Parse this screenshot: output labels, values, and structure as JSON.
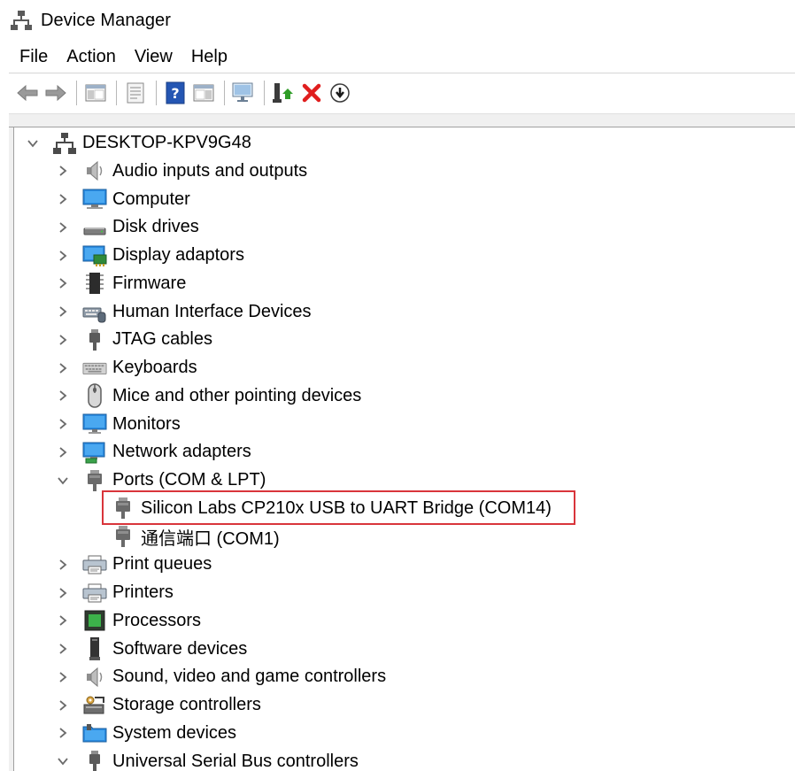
{
  "window": {
    "title": "Device Manager"
  },
  "menu": [
    "File",
    "Action",
    "View",
    "Help"
  ],
  "toolbar": {
    "buttons": [
      "back-icon",
      "forward-icon",
      "console-tree-icon",
      "properties-icon",
      "help-icon",
      "action-pane-icon",
      "scan-hardware-icon",
      "update-driver-icon",
      "uninstall-icon",
      "disable-device-icon"
    ]
  },
  "tree": {
    "root": "DESKTOP-KPV9G48",
    "categories": [
      {
        "label": "Audio inputs and outputs",
        "icon": "speaker-icon"
      },
      {
        "label": "Computer",
        "icon": "computer-icon"
      },
      {
        "label": "Disk drives",
        "icon": "disk-drive-icon"
      },
      {
        "label": "Display adaptors",
        "icon": "display-adapter-icon"
      },
      {
        "label": "Firmware",
        "icon": "firmware-icon"
      },
      {
        "label": "Human Interface Devices",
        "icon": "hid-icon"
      },
      {
        "label": "JTAG cables",
        "icon": "usb-plug-icon"
      },
      {
        "label": "Keyboards",
        "icon": "keyboard-icon"
      },
      {
        "label": "Mice and other pointing devices",
        "icon": "mouse-icon"
      },
      {
        "label": "Monitors",
        "icon": "monitor-icon"
      },
      {
        "label": "Network adapters",
        "icon": "network-adapter-icon"
      },
      {
        "label": "Ports (COM & LPT)",
        "icon": "port-icon"
      },
      {
        "label": "Print queues",
        "icon": "printer-icon"
      },
      {
        "label": "Printers",
        "icon": "printer-icon"
      },
      {
        "label": "Processors",
        "icon": "processor-icon"
      },
      {
        "label": "Software devices",
        "icon": "software-device-icon"
      },
      {
        "label": "Sound, video and game controllers",
        "icon": "speaker-icon"
      },
      {
        "label": "Storage controllers",
        "icon": "storage-controller-icon"
      },
      {
        "label": "System devices",
        "icon": "system-folder-icon"
      },
      {
        "label": "Universal Serial Bus controllers",
        "icon": "usb-plug-icon"
      }
    ],
    "ports_children": [
      {
        "label": "Silicon Labs CP210x USB to UART Bridge (COM14)",
        "icon": "port-icon"
      },
      {
        "label": "通信端口 (COM1)",
        "icon": "port-icon"
      }
    ]
  },
  "colors": {
    "highlight_border": "#d9353b",
    "chevron": "#6b6b6b"
  }
}
